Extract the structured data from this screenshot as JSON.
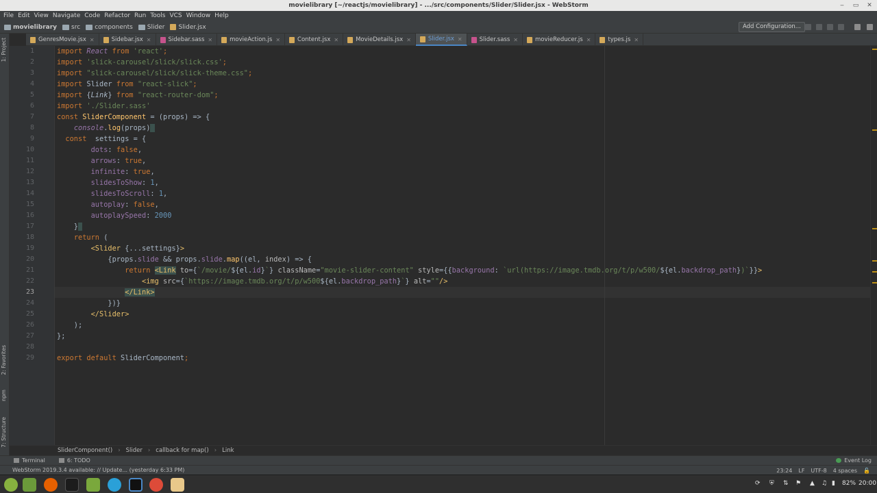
{
  "window": {
    "title": "movielibrary [~/reactjs/movielibrary] - .../src/components/Slider/Slider.jsx - WebStorm",
    "controls": [
      "‒",
      "▭",
      "✕"
    ]
  },
  "menu": [
    "File",
    "Edit",
    "View",
    "Navigate",
    "Code",
    "Refactor",
    "Run",
    "Tools",
    "VCS",
    "Window",
    "Help"
  ],
  "breadcrumb": [
    "movielibrary",
    "src",
    "components",
    "Slider",
    "Slider.jsx"
  ],
  "toolbar": {
    "add_configuration": "Add Configuration..."
  },
  "tabs": [
    {
      "label": "GenresMovie.jsx",
      "color": "#d4a95a"
    },
    {
      "label": "Sidebar.jsx",
      "color": "#d4a95a"
    },
    {
      "label": "Sidebar.sass",
      "color": "#c6538c"
    },
    {
      "label": "movieAction.js",
      "color": "#d4a95a"
    },
    {
      "label": "Content.jsx",
      "color": "#d4a95a"
    },
    {
      "label": "MovieDetails.jsx",
      "color": "#d4a95a"
    },
    {
      "label": "Slider.jsx",
      "color": "#d4a95a",
      "active": true
    },
    {
      "label": "Slider.sass",
      "color": "#c6538c"
    },
    {
      "label": "movieReducer.js",
      "color": "#d4a95a"
    },
    {
      "label": "types.js",
      "color": "#d4a95a"
    }
  ],
  "side_tools": {
    "project": "1: Project",
    "favorites": "2: Favorites",
    "npm": "npm",
    "structure": "7: Structure"
  },
  "line_numbers": [
    "1",
    "2",
    "3",
    "4",
    "5",
    "6",
    "7",
    "8",
    "9",
    "10",
    "11",
    "12",
    "13",
    "14",
    "15",
    "16",
    "17",
    "18",
    "19",
    "20",
    "21",
    "22",
    "23",
    "24",
    "25",
    "26",
    "27",
    "28",
    "29"
  ],
  "current_line": "23",
  "editor_breadcrumb": [
    "SliderComponent()",
    "Slider",
    "callback for map()",
    "Link"
  ],
  "bottom_tools": {
    "terminal": "Terminal",
    "todo": "6: TODO",
    "event_log": "Event Log"
  },
  "status": {
    "message": "WebStorm 2019.3.4 available: // Update... (yesterday 6:33 PM)",
    "position": "23:24",
    "line_sep": "LF",
    "encoding": "UTF-8",
    "indent": "4 spaces"
  },
  "taskbar": {
    "battery": "82%",
    "time": "20:00"
  },
  "colors": {
    "editor_bg": "#2b2b2b",
    "keyword": "#cc7832",
    "string": "#6a8759",
    "number": "#6897bb",
    "property": "#9876aa",
    "accent": "#4a88c7"
  }
}
